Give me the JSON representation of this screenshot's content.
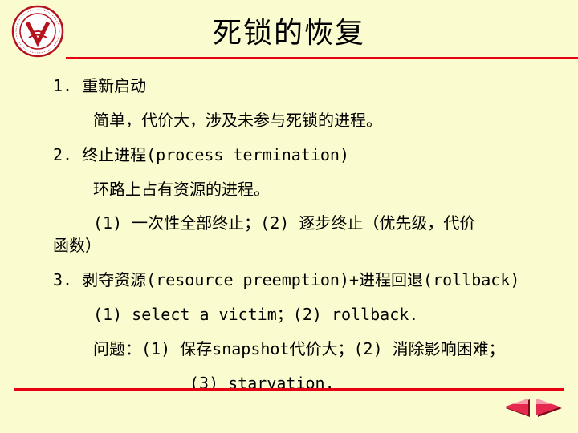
{
  "slide": {
    "title": "死锁的恢复",
    "lines": [
      "1. 重新启动",
      "简单，代价大，涉及未参与死锁的进程。",
      "2. 终止进程(process termination)",
      "环路上占有资源的进程。",
      "(1) 一次性全部终止；(2) 逐步终止（优先级，代价",
      "函数）",
      "3. 剥夺资源(resource preemption)+进程回退(rollback)",
      "(1) select a victim；(2) rollback.",
      "问题：(1) 保存snapshot代价大；(2) 消除影响困难；",
      "(3) starvation."
    ]
  },
  "logo": {
    "icon": "university-seal-icon"
  },
  "nav": {
    "prev_icon": "arrow-left-icon",
    "next_icon": "arrow-right-icon"
  },
  "colors": {
    "background": "#fbfbd0",
    "rule": "#e60012",
    "nav_arrow": "#e6294e"
  }
}
